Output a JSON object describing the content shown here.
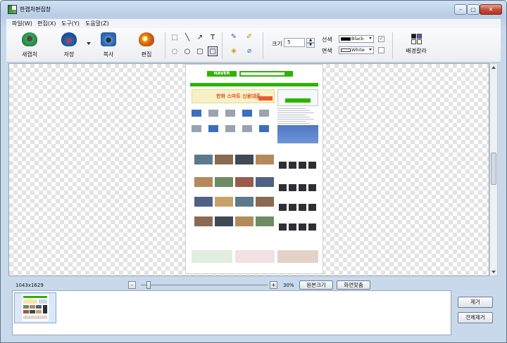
{
  "window": {
    "title": "한캡처편집창",
    "min_glyph": "–",
    "max_glyph": "▢",
    "close_glyph": "✕"
  },
  "menu": {
    "items": [
      "파일(W)",
      "편집(X)",
      "도구(Y)",
      "도움말(Z)"
    ]
  },
  "toolbar": {
    "new_capture": "새캡처",
    "save": "저장",
    "copy": "복사",
    "edit": "편집",
    "shape_tools": [
      {
        "icon": "rect-select-icon",
        "glyph": "⬚"
      },
      {
        "icon": "line-icon",
        "glyph": "╲"
      },
      {
        "icon": "arrow-icon",
        "glyph": "↗"
      },
      {
        "icon": "text-icon",
        "glyph": "T"
      },
      {
        "icon": "ellipse-select-icon",
        "glyph": "◌"
      },
      {
        "icon": "circle-icon",
        "glyph": "○"
      },
      {
        "icon": "rounded-rect-icon",
        "glyph": "▢"
      },
      {
        "icon": "rectangle-icon",
        "glyph": "□"
      }
    ],
    "pen_tools": [
      {
        "icon": "pencil-icon",
        "glyph": "✎",
        "color": "#2a64c5"
      },
      {
        "icon": "marker-icon",
        "glyph": "✐",
        "color": "#b59b00"
      },
      {
        "icon": "fill-bucket-icon",
        "glyph": "◈",
        "color": "#c8a200"
      },
      {
        "icon": "eraser-icon",
        "glyph": "⌀",
        "color": "#3a6fc0"
      }
    ],
    "size_label": "크기",
    "size_value": "5",
    "line_label": "선색",
    "line_color_name": "Black",
    "line_color": "#000000",
    "line_checked": true,
    "face_label": "면색",
    "face_color_name": "White",
    "face_color": "#ffffff",
    "face_checked": false,
    "bg_color_label": "배경칼라",
    "bg_grid_colors": [
      "#1a1a1a",
      "#6b4fb3",
      "#ffffff",
      "#ffffff"
    ]
  },
  "status": {
    "image_size": "1043x1629",
    "zoom_percent": "30%",
    "zoom_minus": "-",
    "zoom_plus": "+",
    "original_size": "원본크기",
    "fit_screen": "화면맞춤"
  },
  "captured_page": {
    "logo": "NAVER",
    "banner_text": "한화 스마트 신용대출"
  },
  "side_buttons": {
    "remove": "제거",
    "remove_all": "전체제거"
  }
}
